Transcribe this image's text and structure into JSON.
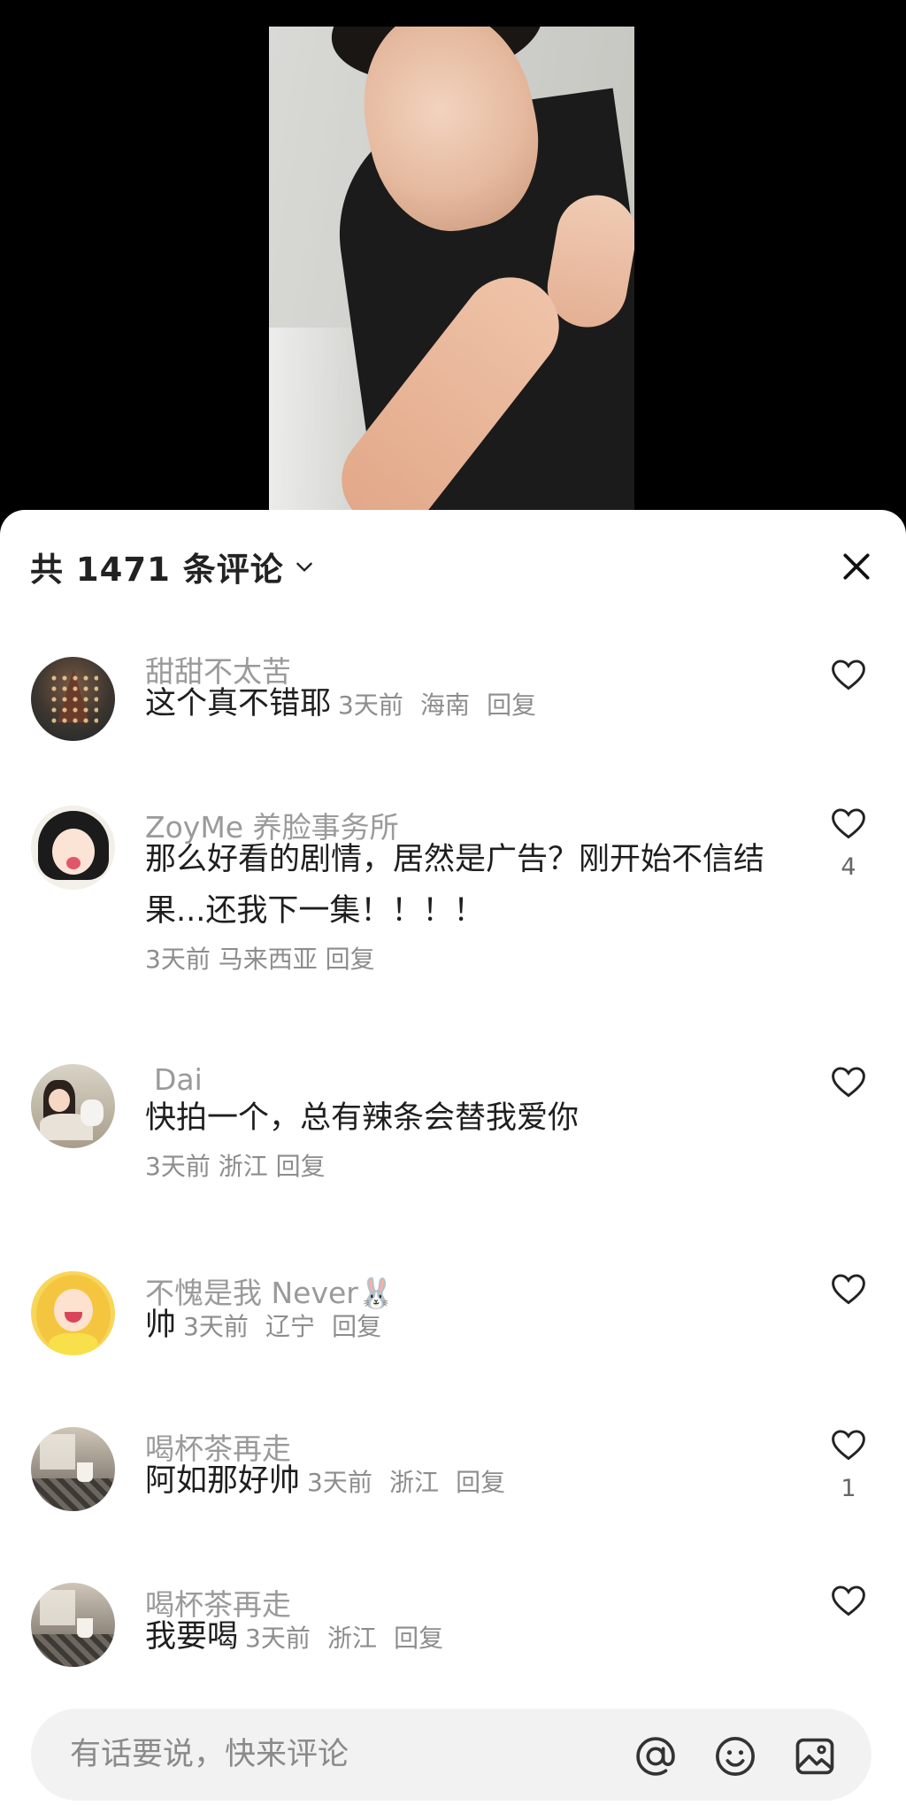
{
  "header": {
    "comment_count_title": "共 1471 条评论"
  },
  "icons": {
    "expand": "chevron-down-icon",
    "close": "close-icon",
    "like": "heart-outline-icon",
    "mention": "at-icon",
    "emoji": "smiley-icon",
    "image": "image-icon"
  },
  "comments": [
    {
      "username": "甜甜不太苦",
      "text": "这个真不错耶",
      "time": "3天前",
      "location": "海南",
      "reply": "回复",
      "likes": ""
    },
    {
      "username": "ZoyMe 养脸事务所",
      "text": "那么好看的剧情，居然是广告？刚开始不信结果...还我下一集！！！！",
      "time": "3天前",
      "location": "马来西亚",
      "reply": "回复",
      "likes": "4"
    },
    {
      "username": "Dai",
      "text": "快拍一个，总有辣条会替我爱你",
      "time": "3天前",
      "location": "浙江",
      "reply": "回复",
      "likes": ""
    },
    {
      "username": "不愧是我 Never🐰",
      "text": "帅",
      "time": "3天前",
      "location": "辽宁",
      "reply": "回复",
      "likes": ""
    },
    {
      "username": "喝杯茶再走",
      "text": "阿如那好帅",
      "time": "3天前",
      "location": "浙江",
      "reply": "回复",
      "likes": "1"
    },
    {
      "username": "喝杯茶再走",
      "text": "我要喝",
      "time": "3天前",
      "location": "浙江",
      "reply": "回复",
      "likes": ""
    }
  ],
  "input": {
    "placeholder": "有话要说，快来评论"
  }
}
